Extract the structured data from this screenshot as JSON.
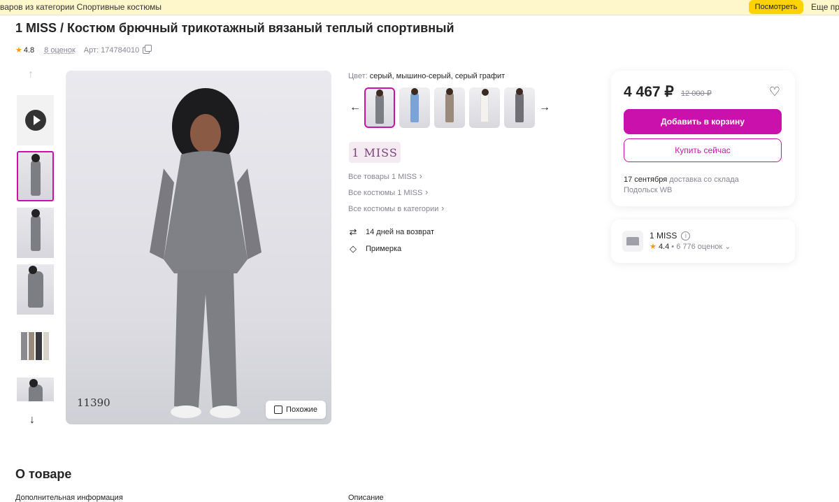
{
  "banner": {
    "text": "варов из категории Спортивные костюмы",
    "button": "Посмотреть",
    "more": "Еще пре"
  },
  "product": {
    "title": "1 MISS / Костюм брючный трикотажный вязаный теплый спортивный",
    "rating": "4.8",
    "reviews": "8 оценок",
    "article": "Арт: 174784010",
    "image_code": "11390",
    "similar_label": "Похожие"
  },
  "colors": {
    "label": "Цвет:",
    "value": "серый, мышино-серый, серый графит",
    "swatches": [
      "#7d7d84",
      "#7aa3d8",
      "#9a8a7c",
      "#e8e6e2",
      "#6f6f75"
    ]
  },
  "brand": {
    "logo_text": "1 MISS",
    "links": [
      "Все товары 1 MISS",
      "Все костюмы 1 MISS",
      "Все костюмы в категории"
    ]
  },
  "features": [
    {
      "icon": "return-icon",
      "label": "14 дней на возврат"
    },
    {
      "icon": "tag-icon",
      "label": "Примерка"
    }
  ],
  "price_card": {
    "price": "4 467 ₽",
    "old_price": "12 000 ₽",
    "add_to_cart": "Добавить в корзину",
    "buy_now": "Купить сейчас",
    "delivery_date": "17 сентября",
    "delivery_text": "доставка со склада Подольск WB"
  },
  "seller": {
    "name": "1 MISS",
    "rating": "4.4",
    "reviews": "6 776 оценок"
  },
  "sections": {
    "about": "О товаре",
    "left_sub": "Дополнительная информация",
    "right_sub": "Описание"
  },
  "colors_theme": {
    "accent": "#cb11ab",
    "banner_button": "#ffd200",
    "star": "#ff9900"
  }
}
